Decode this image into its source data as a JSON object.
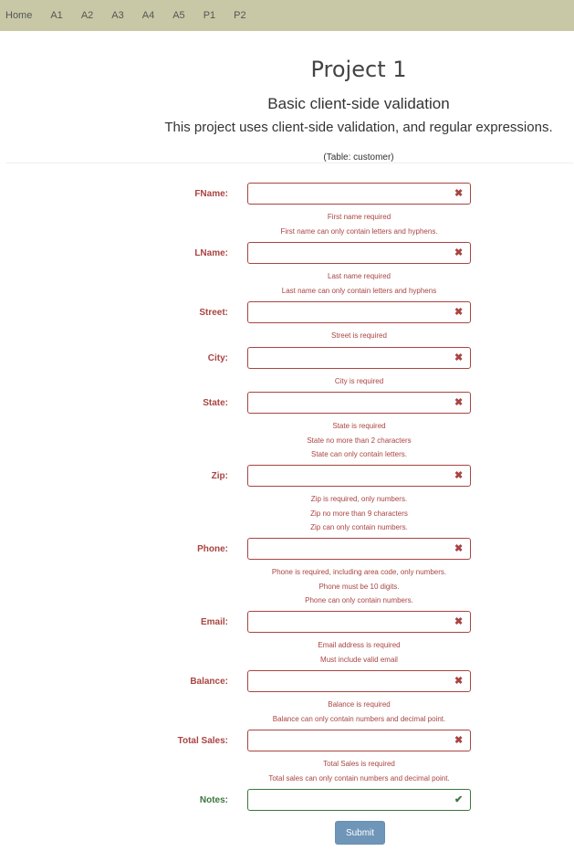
{
  "nav": {
    "items": [
      "Home",
      "A1",
      "A2",
      "A3",
      "A4",
      "A5",
      "P1",
      "P2"
    ]
  },
  "header": {
    "title": "Project 1",
    "subtitle": "Basic client-side validation",
    "description": "This project uses client-side validation, and regular expressions.",
    "table_note": "(Table: customer)"
  },
  "form": {
    "fields": [
      {
        "label": "FName:",
        "icon": "✖",
        "errors": [
          "First name required",
          "First name can only contain letters and hyphens."
        ]
      },
      {
        "label": "LName:",
        "icon": "✖",
        "errors": [
          "Last name required",
          "Last name can only contain letters and hyphens"
        ]
      },
      {
        "label": "Street:",
        "icon": "✖",
        "errors": [
          "Street is required"
        ]
      },
      {
        "label": "City:",
        "icon": "✖",
        "errors": [
          "City is required"
        ]
      },
      {
        "label": "State:",
        "icon": "✖",
        "errors": [
          "State is required",
          "State no more than 2 characters",
          "State can only contain letters."
        ]
      },
      {
        "label": "Zip:",
        "icon": "✖",
        "errors": [
          "Zip is required, only numbers.",
          "Zip no more than 9 characters",
          "Zip can only contain numbers."
        ]
      },
      {
        "label": "Phone:",
        "icon": "✖",
        "errors": [
          "Phone is required, including area code, only numbers.",
          "Phone must be 10 digits.",
          "Phone can only contain numbers."
        ]
      },
      {
        "label": "Email:",
        "icon": "✖",
        "errors": [
          "Email address is required",
          "Must include valid email"
        ]
      },
      {
        "label": "Balance:",
        "icon": "✖",
        "errors": [
          "Balance is required",
          "Balance can only contain numbers and decimal point."
        ]
      },
      {
        "label": "Total Sales:",
        "icon": "✖",
        "errors": [
          "Total Sales is required",
          "Total sales can only contain numbers and decimal point."
        ]
      },
      {
        "label": "Notes:",
        "icon": "✔",
        "errors": []
      }
    ],
    "submit_label": "Submit"
  },
  "colors": {
    "navbar": "#c8c8a7",
    "error": "#a94442",
    "success": "#3c763d",
    "submit": "#6f95b8"
  }
}
